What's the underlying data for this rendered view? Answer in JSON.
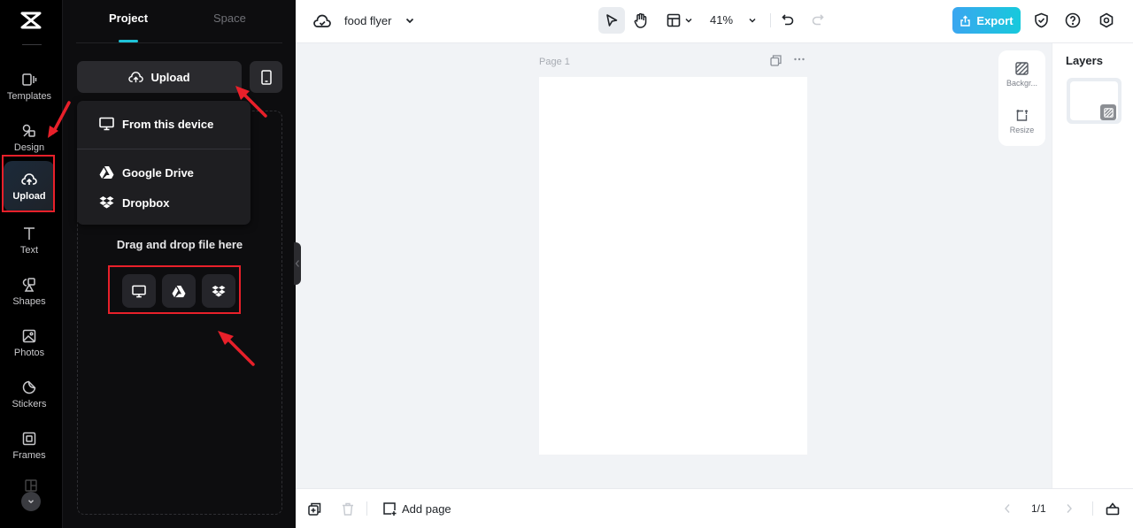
{
  "rail": {
    "items": [
      {
        "label": "Templates",
        "icon": "templates-icon"
      },
      {
        "label": "Design",
        "icon": "design-icon"
      },
      {
        "label": "Upload",
        "icon": "upload-cloud-icon",
        "active": true
      },
      {
        "label": "Text",
        "icon": "text-icon"
      },
      {
        "label": "Shapes",
        "icon": "shapes-icon"
      },
      {
        "label": "Photos",
        "icon": "photos-icon"
      },
      {
        "label": "Stickers",
        "icon": "stickers-icon"
      },
      {
        "label": "Frames",
        "icon": "frames-icon"
      }
    ]
  },
  "panel": {
    "tabs": [
      {
        "label": "Project",
        "active": true
      },
      {
        "label": "Space",
        "active": false
      }
    ],
    "upload_label": "Upload",
    "upload_menu": [
      {
        "label": "From this device",
        "icon": "monitor-icon"
      },
      {
        "label": "Google Drive",
        "icon": "google-drive-icon"
      },
      {
        "label": "Dropbox",
        "icon": "dropbox-icon"
      }
    ],
    "drag_text": "Drag and drop file here"
  },
  "topbar": {
    "title": "food flyer",
    "zoom": "41%",
    "export_label": "Export"
  },
  "canvas": {
    "page_label": "Page 1"
  },
  "float_tools": [
    {
      "label": "Backgr...",
      "icon": "background-icon"
    },
    {
      "label": "Resize",
      "icon": "resize-icon"
    }
  ],
  "layers": {
    "title": "Layers"
  },
  "bottombar": {
    "add_page_label": "Add page",
    "page_count": "1/1"
  },
  "colors": {
    "accent": "#1ec3d8",
    "export_gradient_start": "#3aa6f0",
    "export_gradient_end": "#17c9dc",
    "annotation": "#e8202a"
  }
}
